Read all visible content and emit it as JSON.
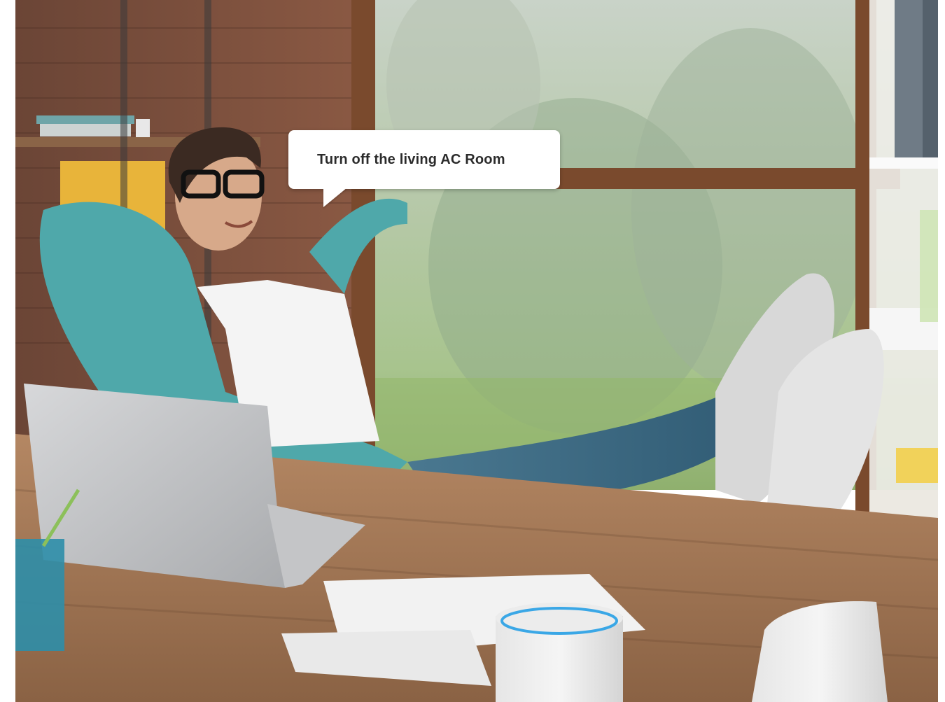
{
  "speech_bubble": {
    "text": "Turn off the living AC Room"
  },
  "colors": {
    "bubble_background": "#ffffff",
    "bubble_text": "#2b2b2b",
    "echo_ring": "#3aa7e6"
  },
  "scene": {
    "icons": [
      "person-figure",
      "laptop-icon",
      "smart-speaker-echo-icon",
      "smart-speaker-home-icon",
      "pencil-cup-icon"
    ]
  }
}
